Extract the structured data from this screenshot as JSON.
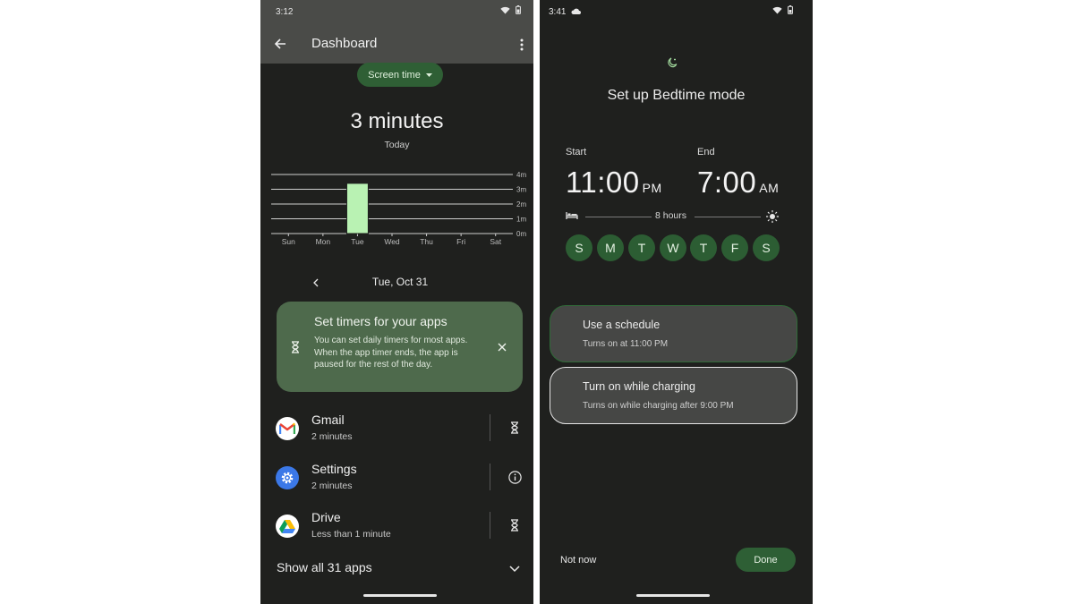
{
  "left": {
    "status_time": "3:12",
    "appbar_title": "Dashboard",
    "chip_label": "Screen time",
    "total": "3 minutes",
    "total_sub": "Today",
    "chart_data": {
      "type": "bar",
      "categories": [
        "Sun",
        "Mon",
        "Tue",
        "Wed",
        "Thu",
        "Fri",
        "Sat"
      ],
      "values": [
        0,
        0,
        3.4,
        0,
        0,
        0,
        0
      ],
      "y_ticks": [
        "4m",
        "3m",
        "2m",
        "1m",
        "0m"
      ],
      "ylim": [
        0,
        4
      ],
      "bar_color": "#b9f2b3"
    },
    "date": "Tue, Oct 31",
    "tip": {
      "title": "Set timers for your apps",
      "body": "You can set daily timers for most apps. When the app timer ends, the app is paused for the rest of the day."
    },
    "apps": [
      {
        "name": "Gmail",
        "time": "2 minutes",
        "icon": "gmail-icon",
        "action": "hourglass-icon"
      },
      {
        "name": "Settings",
        "time": "2 minutes",
        "icon": "settings-gear-icon",
        "action": "info-icon"
      },
      {
        "name": "Drive",
        "time": "Less than 1 minute",
        "icon": "drive-icon",
        "action": "hourglass-icon"
      }
    ],
    "show_all": "Show all 31 apps"
  },
  "right": {
    "status_time": "3:41",
    "title": "Set up Bedtime mode",
    "start_label": "Start",
    "start_time": "11:00",
    "start_ampm": "PM",
    "end_label": "End",
    "end_time": "7:00",
    "end_ampm": "AM",
    "duration": "8 hours",
    "days": [
      "S",
      "M",
      "T",
      "W",
      "T",
      "F",
      "S"
    ],
    "options": [
      {
        "title": "Use a schedule",
        "sub": "Turns on at 11:00 PM"
      },
      {
        "title": "Turn on while charging",
        "sub": "Turns on while charging after 9:00 PM"
      }
    ],
    "not_now": "Not now",
    "done": "Done"
  },
  "colors": {
    "background": "#1f201e",
    "accent_green": "#2e5f35",
    "bar_green": "#b9f2b3",
    "tip_card": "#4e6a4c"
  }
}
